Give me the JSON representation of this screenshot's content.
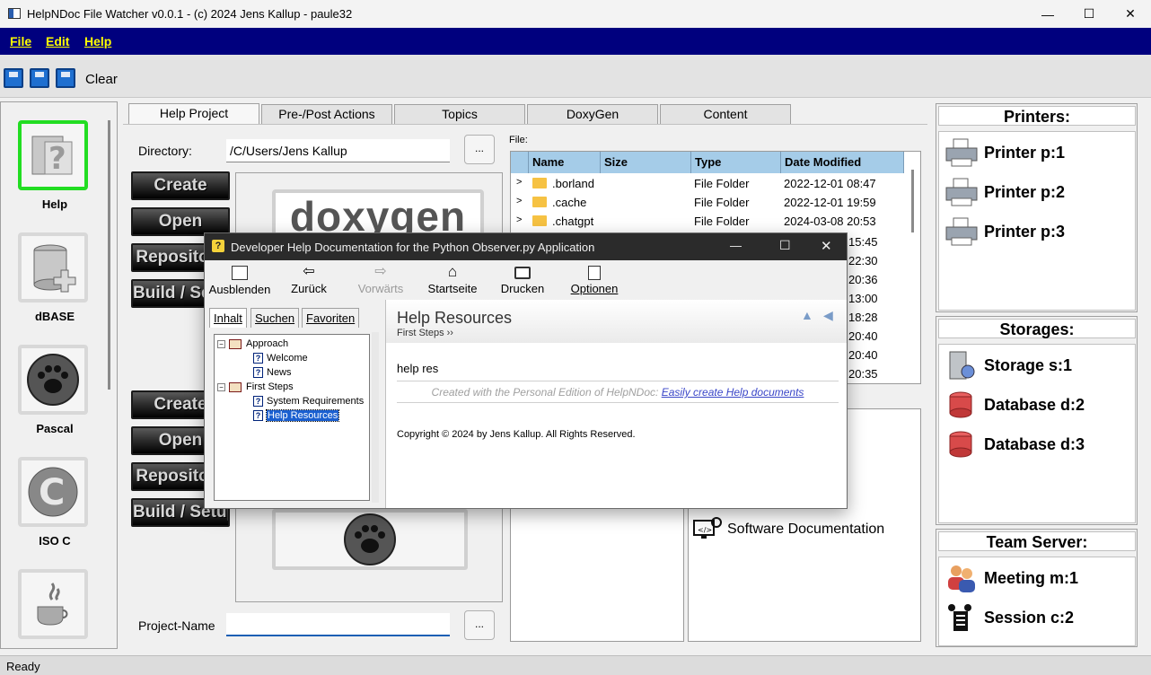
{
  "window": {
    "title": "HelpNDoc File Watcher v0.0.1 - (c) 2024 Jens Kallup - paule32"
  },
  "menu": {
    "file": "File",
    "edit": "Edit",
    "help": "Help"
  },
  "toolbar": {
    "clear_label": "Clear"
  },
  "sidebar": {
    "items": [
      {
        "label": "Help",
        "icon": "help-icon",
        "selected": true
      },
      {
        "label": "dBASE",
        "icon": "database-icon"
      },
      {
        "label": "Pascal",
        "icon": "paw-icon"
      },
      {
        "label": "ISO C",
        "icon": "c-letter-icon"
      },
      {
        "label": "",
        "icon": "java-icon"
      }
    ]
  },
  "tabs": [
    "Help Project",
    "Pre-/Post Actions",
    "Topics",
    "DoxyGen",
    "Content"
  ],
  "project": {
    "directory_label": "Directory:",
    "directory_value": "/C/Users/Jens Kallup",
    "browse_label": "...",
    "project_name_label": "Project-Name",
    "project_name_value": "",
    "buttons_top": [
      "Create",
      "Open",
      "Repository",
      "Build / Setup"
    ],
    "buttons_bottom": [
      "Create",
      "Open",
      "Repository",
      "Build / Setup"
    ],
    "doxygen_logo": "doxygen"
  },
  "files": {
    "label": "File:",
    "columns": [
      "Name",
      "Size",
      "Type",
      "Date Modified"
    ],
    "rows": [
      {
        "name": ".borland",
        "size": "",
        "type": "File Folder",
        "date": "2022-12-01 08:47"
      },
      {
        "name": ".cache",
        "size": "",
        "type": "File Folder",
        "date": "2022-12-01 19:59"
      },
      {
        "name": ".chatgpt",
        "size": "",
        "type": "File Folder",
        "date": "2024-03-08 20:53"
      }
    ],
    "partial_times": [
      "15:45",
      "22:30",
      "20:36",
      "13:00",
      "18:28",
      "20:40",
      "20:40",
      "20:35"
    ]
  },
  "doc_panel": {
    "software_doc": "Software Documentation"
  },
  "right": {
    "printers_title": "Printers:",
    "printers": [
      "Printer p:1",
      "Printer p:2",
      "Printer p:3"
    ],
    "storages_title": "Storages:",
    "storages": [
      "Storage  s:1",
      "Database d:2",
      "Database d:3"
    ],
    "team_title": "Team Server:",
    "team": [
      "Meeting m:1",
      "Session c:2"
    ]
  },
  "status": {
    "text": "Ready"
  },
  "help_window": {
    "title": "Developer Help Documentation for the Python Observer.py Application",
    "toolbar": [
      "Ausblenden",
      "Zurück",
      "Vorwärts",
      "Startseite",
      "Drucken",
      "Optionen"
    ],
    "tabs": [
      "Inhalt",
      "Suchen",
      "Favoriten"
    ],
    "tree": [
      {
        "label": "Approach",
        "level": 0,
        "kind": "book"
      },
      {
        "label": "Welcome",
        "level": 1,
        "kind": "page"
      },
      {
        "label": "News",
        "level": 1,
        "kind": "page"
      },
      {
        "label": "First Steps",
        "level": 0,
        "kind": "book"
      },
      {
        "label": "System Requirements",
        "level": 1,
        "kind": "page"
      },
      {
        "label": "Help Resources",
        "level": 1,
        "kind": "page",
        "selected": true
      }
    ],
    "page_title": "Help Resources",
    "breadcrumb": "First Steps ››",
    "body_text": "help res",
    "footer_note": "Created with the Personal Edition of HelpNDoc:",
    "footer_link": "Easily create Help documents",
    "copyright": "Copyright © 2024 by Jens Kallup. All Rights Reserved."
  },
  "colors": {
    "menu_bg": "#00007e",
    "menu_fg": "#ffff00",
    "selected_border": "#22dd22",
    "list_header": "#a5cce8",
    "link": "#3a46c8"
  }
}
